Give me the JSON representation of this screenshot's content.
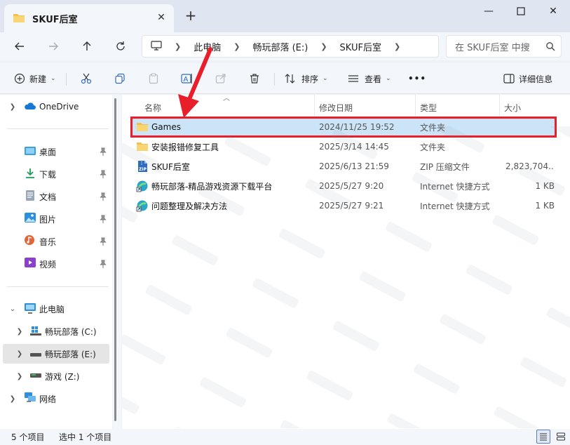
{
  "window": {
    "tab_title": "SKUF后室",
    "tab_close": "✕",
    "new_tab": "+",
    "minimize": "—",
    "close": "✕"
  },
  "nav": {
    "breadcrumbs": [
      "此电脑",
      "畅玩部落 (E:)",
      "SKUF后室"
    ],
    "search_placeholder": "在 SKUF后室 中搜"
  },
  "toolbar": {
    "new_label": "新建",
    "sort_label": "排序",
    "view_label": "查看",
    "more_label": "•••",
    "details_label": "详细信息"
  },
  "sidebar": {
    "onedrive": "OneDrive",
    "quick_access": [
      {
        "label": "桌面",
        "icon": "desktop-icon"
      },
      {
        "label": "下载",
        "icon": "download-icon"
      },
      {
        "label": "文档",
        "icon": "document-icon"
      },
      {
        "label": "图片",
        "icon": "pictures-icon"
      },
      {
        "label": "音乐",
        "icon": "music-icon"
      },
      {
        "label": "视频",
        "icon": "video-icon"
      }
    ],
    "this_pc": "此电脑",
    "drives": [
      {
        "label": "畅玩部落 (C:)"
      },
      {
        "label": "畅玩部落 (E:)"
      },
      {
        "label": "游戏 (Z:)"
      }
    ],
    "network": "网络"
  },
  "columns": {
    "name": "名称",
    "date": "修改日期",
    "type": "类型",
    "size": "大小"
  },
  "files": [
    {
      "name": "Games",
      "date": "2024/11/25 19:52",
      "type": "文件夹",
      "size": "",
      "icon": "folder-icon"
    },
    {
      "name": "安装报错修复工具",
      "date": "2025/3/14 14:45",
      "type": "文件夹",
      "size": "",
      "icon": "folder-icon"
    },
    {
      "name": "SKUF后室",
      "date": "2025/6/13 21:59",
      "type": "ZIP 压缩文件",
      "size": "2,823,704...",
      "icon": "zip-icon"
    },
    {
      "name": "畅玩部落-精品游戏资源下载平台",
      "date": "2025/5/27 9:20",
      "type": "Internet 快捷方式",
      "size": "1 KB",
      "icon": "internet-shortcut-icon"
    },
    {
      "name": "问题整理及解决方法",
      "date": "2025/5/27 9:21",
      "type": "Internet 快捷方式",
      "size": "1 KB",
      "icon": "internet-shortcut-icon"
    }
  ],
  "status": {
    "count": "5 个项目",
    "selected": "选中 1 个项目"
  },
  "colors": {
    "selection": "#cce4f7",
    "highlight_border": "#e81e2b",
    "annotation_arrow": "#e81e2b",
    "folder": "#f4c04d"
  }
}
